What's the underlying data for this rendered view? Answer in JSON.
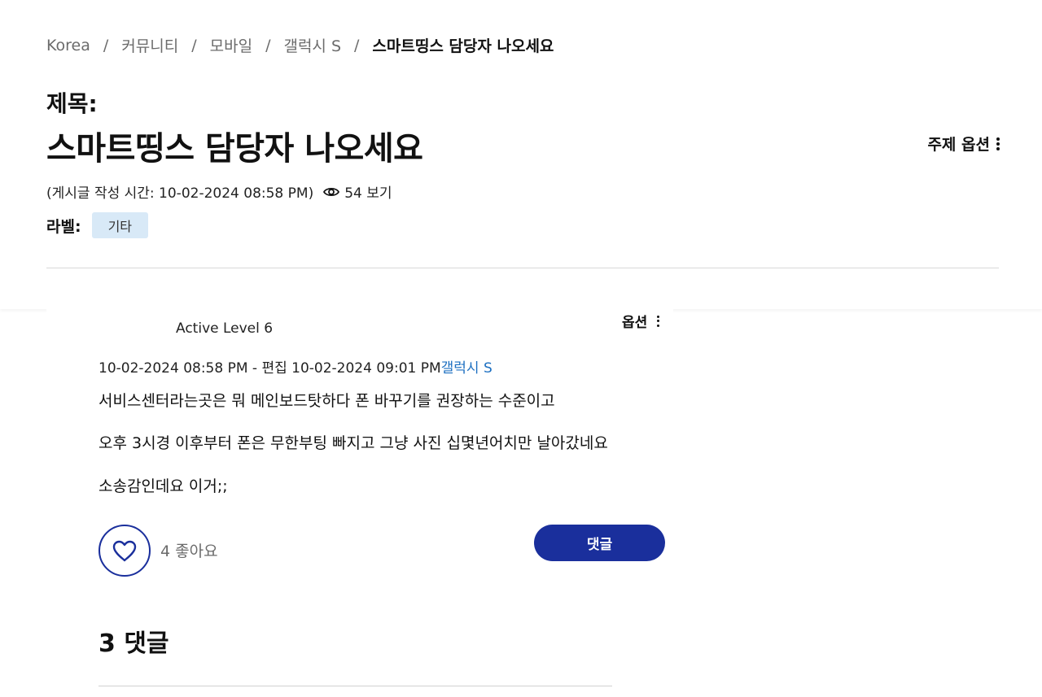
{
  "breadcrumb": {
    "items": [
      "Korea",
      "커뮤니티",
      "모바일",
      "갤럭시 S"
    ],
    "separator": "/",
    "current": "스마트띵스 담당자 나오세요"
  },
  "header": {
    "subject_label": "제목:",
    "title": "스마트띵스 담당자 나오세요",
    "topic_options_label": "주제 옵션",
    "posted_text": "(게시글 작성 시간: 10-02-2024 08:58 PM)",
    "views_text": "54 보기",
    "labels_title": "라벨:",
    "label_chip": "기타"
  },
  "post": {
    "author_level": "Active Level 6",
    "options_label": "옵션",
    "date_text": "10-02-2024 08:58 PM - 편집 10-02-2024 09:01 PM",
    "board_link": "갤럭시 S",
    "body": [
      "서비스센터라는곳은 뭐 메인보드탓하다 폰 바꾸기를 권장하는 수준이고",
      "오후 3시경 이후부터 폰은 무한부팅 빠지고 그냥 사진 십몇년어치만 날아갔네요",
      "소송감인데요 이거;;"
    ],
    "likes_text": "4 좋아요",
    "reply_label": "댓글"
  },
  "comments": {
    "heading": "3 댓글"
  },
  "colors": {
    "accent": "#1a2f9c",
    "link": "#1c6fc1",
    "label_chip_bg": "#d8e9f7",
    "muted_text": "#6b6b6b"
  },
  "icons": {
    "views": "eye-icon",
    "like": "heart-icon",
    "options": "kebab-menu-icon"
  }
}
